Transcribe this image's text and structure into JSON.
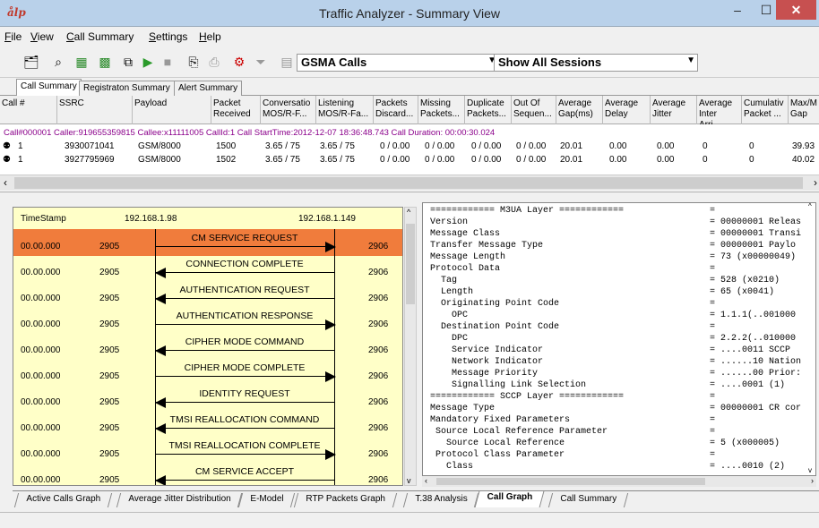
{
  "window": {
    "title": "Traffic Analyzer - Summary View",
    "logo": "ålp",
    "min": "–",
    "max": "☐",
    "close": "✕"
  },
  "menu": [
    "File",
    "View",
    "Call Summary",
    "Settings",
    "Help"
  ],
  "toolbar": {
    "call_type": "GSMA Calls",
    "session_filter": "Show All Sessions"
  },
  "top_tabs": [
    "Call Summary",
    "Registraton Summary",
    "Alert Summary"
  ],
  "table": {
    "headers": [
      "Call #",
      "SSRC",
      "Payload",
      "Packet Received",
      "Conversatio MOS/R-F...",
      "Listening MOS/R-Fa...",
      "Packets Discard...",
      "Missing Packets...",
      "Duplicate Packets...",
      "Out Of Sequen...",
      "Average Gap(ms)",
      "Average Delay",
      "Average Jitter",
      "Average Inter Arri...",
      "Cumulativ Packet ...",
      "Max/M Gap"
    ],
    "call_info": "Call#000001  Caller:919655359815 Callee:x11111005 CallId:1 Call StartTime:2012-12-07 18:36:48.743 Call Duration: 00:00:30.024",
    "rows": [
      [
        "1",
        "3930071041",
        "GSM/8000",
        "1500",
        "3.65 / 75",
        "3.65 / 75",
        "0 / 0.00",
        "0 / 0.00",
        "0 / 0.00",
        "0 / 0.00",
        "20.01",
        "0.00",
        "0.00",
        "0",
        "0",
        "39.93"
      ],
      [
        "1",
        "3927795969",
        "GSM/8000",
        "1502",
        "3.65 / 75",
        "3.65 / 75",
        "0 / 0.00",
        "0 / 0.00",
        "0 / 0.00",
        "0 / 0.00",
        "20.01",
        "0.00",
        "0.00",
        "0",
        "0",
        "40.02"
      ]
    ]
  },
  "ladder": {
    "ts_label": "TimeStamp",
    "ip_a": "192.168.1.98",
    "ip_b": "192.168.1.149",
    "flows": [
      {
        "ts": "00.00.000",
        "pa": "2905",
        "label": "CM SERVICE REQUEST",
        "pb": "2906",
        "dir": "right"
      },
      {
        "ts": "00.00.000",
        "pa": "2905",
        "label": "CONNECTION COMPLETE",
        "pb": "2906",
        "dir": "left"
      },
      {
        "ts": "00.00.000",
        "pa": "2905",
        "label": "AUTHENTICATION REQUEST",
        "pb": "2906",
        "dir": "left"
      },
      {
        "ts": "00.00.000",
        "pa": "2905",
        "label": "AUTHENTICATION RESPONSE",
        "pb": "2906",
        "dir": "right"
      },
      {
        "ts": "00.00.000",
        "pa": "2905",
        "label": "CIPHER MODE COMMAND",
        "pb": "2906",
        "dir": "left"
      },
      {
        "ts": "00.00.000",
        "pa": "2905",
        "label": "CIPHER MODE COMPLETE",
        "pb": "2906",
        "dir": "right"
      },
      {
        "ts": "00.00.000",
        "pa": "2905",
        "label": "IDENTITY REQUEST",
        "pb": "2906",
        "dir": "left"
      },
      {
        "ts": "00.00.000",
        "pa": "2905",
        "label": "TMSI REALLOCATION COMMAND",
        "pb": "2906",
        "dir": "left"
      },
      {
        "ts": "00.00.000",
        "pa": "2905",
        "label": "TMSI REALLOCATION COMPLETE",
        "pb": "2906",
        "dir": "right"
      },
      {
        "ts": "00.00.000",
        "pa": "2905",
        "label": "CM SERVICE ACCEPT",
        "pb": "2906",
        "dir": "left"
      }
    ]
  },
  "decode": [
    [
      "============ M3UA Layer ============",
      "="
    ],
    [
      "Version",
      "= 00000001 Releas"
    ],
    [
      "Message Class",
      "= 00000001 Transi"
    ],
    [
      "Transfer Message Type",
      "= 00000001 Paylo"
    ],
    [
      "Message Length",
      "= 73 (x00000049)"
    ],
    [
      "Protocol Data",
      "="
    ],
    [
      "  Tag",
      "= 528 (x0210)"
    ],
    [
      "  Length",
      "= 65 (x0041)"
    ],
    [
      "  Originating Point Code",
      "="
    ],
    [
      "    OPC",
      "= 1.1.1(..001000"
    ],
    [
      "  Destination Point Code",
      "="
    ],
    [
      "    DPC",
      "= 2.2.2(..010000"
    ],
    [
      "    Service Indicator",
      "= ....0011 SCCP"
    ],
    [
      "    Network Indicator",
      "= ......10 Nation"
    ],
    [
      "    Message Priority",
      "= ......00 Prior:"
    ],
    [
      "    Signalling Link Selection",
      "= ....0001 (1)"
    ],
    [
      "============ SCCP Layer ============",
      "="
    ],
    [
      "Message Type",
      "= 00000001 CR cor"
    ],
    [
      "Mandatory Fixed Parameters",
      "="
    ],
    [
      " Source Local Reference Parameter",
      "="
    ],
    [
      "   Source Local Reference",
      "= 5 (x000005)"
    ],
    [
      " Protocol Class Parameter",
      "="
    ],
    [
      "   Class",
      "= ....0010 (2)"
    ]
  ],
  "bottom_tabs": [
    "Active Calls Graph",
    "Average Jitter Distribution",
    "E-Model",
    "RTP Packets Graph",
    "T.38 Analysis",
    "Call Graph",
    "Call Summary"
  ],
  "colors": {
    "highlight": "#f07c3c",
    "pane_bg": "#ffffc8",
    "call_info": "#8b008b"
  }
}
